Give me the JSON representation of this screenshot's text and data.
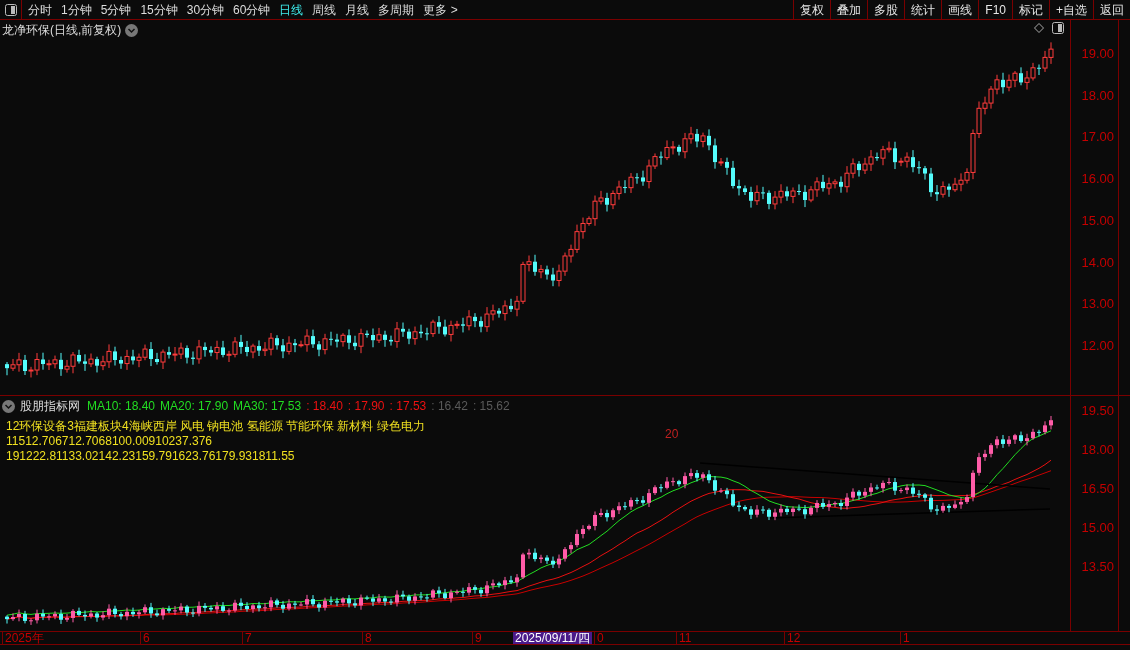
{
  "toolbar": {
    "periods": [
      {
        "label": "分时",
        "selected": false
      },
      {
        "label": "1分钟",
        "selected": false
      },
      {
        "label": "5分钟",
        "selected": false
      },
      {
        "label": "15分钟",
        "selected": false
      },
      {
        "label": "30分钟",
        "selected": false
      },
      {
        "label": "60分钟",
        "selected": false
      },
      {
        "label": "日线",
        "selected": true
      },
      {
        "label": "周线",
        "selected": false
      },
      {
        "label": "月线",
        "selected": false
      },
      {
        "label": "多周期",
        "selected": false
      },
      {
        "label": "更多 >",
        "selected": false
      }
    ],
    "actions": [
      "复权",
      "叠加",
      "多股",
      "统计",
      "画线",
      "F10",
      "标记",
      "+自选",
      "返回"
    ]
  },
  "main_chart": {
    "title": "龙净环保(日线,前复权)",
    "y_labels": [
      "19.00",
      "18.00",
      "17.00",
      "16.00",
      "15.00",
      "14.00",
      "13.00",
      "12.00"
    ]
  },
  "indicator": {
    "title": "股朋指标网",
    "legend": [
      {
        "text": "MA10: 18.40",
        "color": "#22dd22"
      },
      {
        "text": "MA20: 17.90",
        "color": "#22dd22"
      },
      {
        "text": "MA30: 17.53",
        "color": "#22dd22"
      },
      {
        "text": ": 18.40",
        "color": "#ee1111"
      },
      {
        "text": ": 17.90",
        "color": "#ee1111"
      },
      {
        "text": ": 17.53",
        "color": "#ee1111"
      },
      {
        "text": ": 16.42",
        "color": "#5a5a5a"
      },
      {
        "text": ": 15.62",
        "color": "#5a5a5a"
      }
    ],
    "lines": [
      "12环保设备3福建板块4海峡西岸 风电 钠电池 氢能源 节能环保 新材料 绿色电力",
      "11512.706712.7068100.00910237.376",
      "191222.81133.02142.23159.791623.76179.931811.55"
    ],
    "marker": "20",
    "y_labels": [
      "19.50",
      "18.00",
      "16.50",
      "15.00",
      "13.50"
    ]
  },
  "date_axis": [
    {
      "text": "2025年",
      "selected": false
    },
    {
      "text": "6",
      "selected": false
    },
    {
      "text": "7",
      "selected": false
    },
    {
      "text": "8",
      "selected": false
    },
    {
      "text": "9",
      "selected": false
    },
    {
      "text": "2025/09/11/四",
      "selected": true
    },
    {
      "text": "0",
      "selected": false
    },
    {
      "text": "11",
      "selected": false
    },
    {
      "text": "12",
      "selected": false
    },
    {
      "text": "1",
      "selected": false
    }
  ]
}
